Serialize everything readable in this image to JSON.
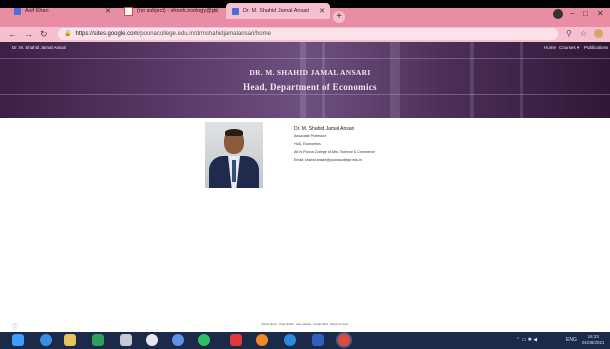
{
  "browser": {
    "tabs": [
      {
        "label": "Asif Khan",
        "active": false
      },
      {
        "label": "(no subject) - shoeb.zoology@p",
        "active": false
      },
      {
        "label": "Dr. M. Shahid Jamal Ansari",
        "active": true
      }
    ],
    "new_tab_label": "+",
    "url_host": "https://sites.google.com",
    "url_path": "/poonacollege.edu.in/drmshahidjamalansari/home"
  },
  "site": {
    "name": "Dr. M. Shahid Jamal Ansari",
    "nav": [
      "Home",
      "Courses",
      "Publications"
    ],
    "hero_title": "DR. M. SHAHID JAMAL ANSARI",
    "hero_subtitle": "Head, Department of Economics"
  },
  "profile": {
    "name": "Dr. M. Shahid Jamal Ansari",
    "lines": [
      "Associate Professor",
      "HoD, Economics",
      "AKI's Poona College of Arts, Science & Commerce",
      "Email: shahid.ansari@poonacollege.edu.in"
    ]
  },
  "footer_text": "Report abuse · Page details · Last updated · Google Sites · Report an issue",
  "taskbar": {
    "language": "ENG",
    "time": "16:33",
    "date": "01/08/2021"
  },
  "colors": {
    "tab_bar": "#e88da3",
    "address_bar": "#f6bfcf",
    "hero": "#5a3b6a",
    "taskbar": "#1c2a4a"
  },
  "icons": [
    "sites-favicon",
    "gmail-favicon",
    "windows-start-icon",
    "ie-icon",
    "file-explorer-icon",
    "chrome-icon",
    "word-icon"
  ]
}
